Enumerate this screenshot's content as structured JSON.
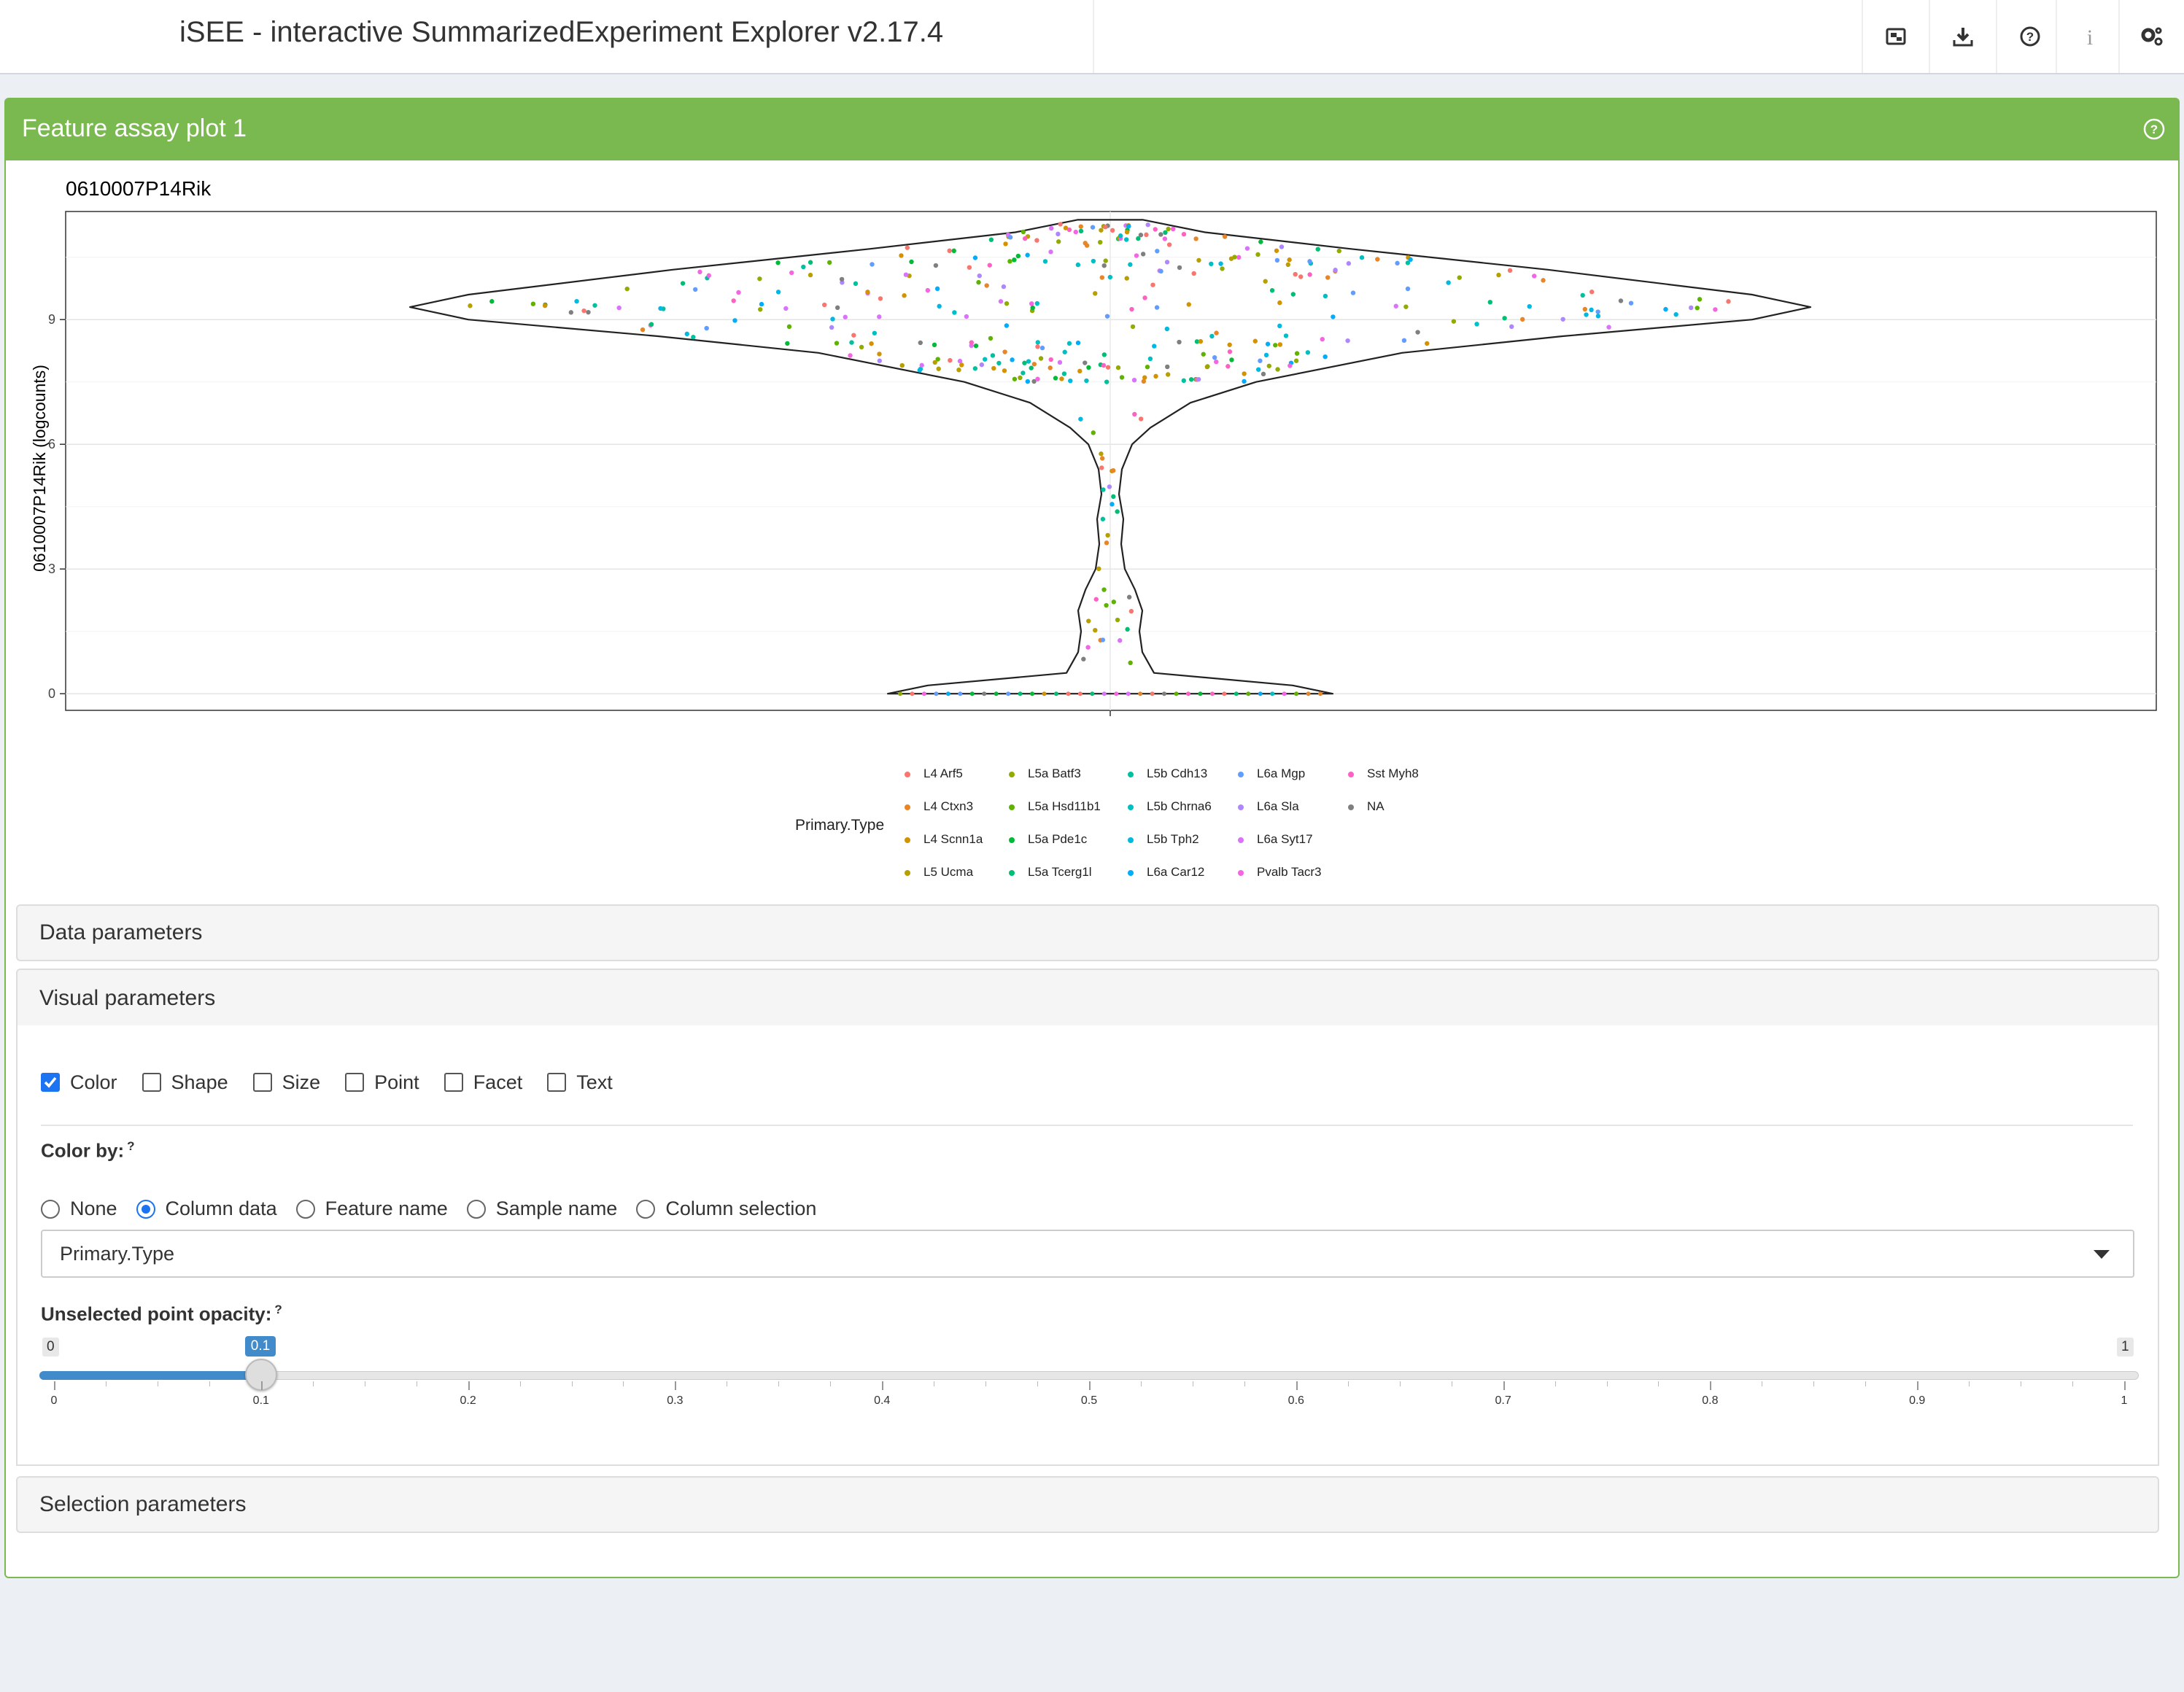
{
  "header": {
    "title": "iSEE - interactive SummarizedExperiment Explorer v2.17.4",
    "buttons": [
      {
        "name": "export-icon"
      },
      {
        "name": "download-icon"
      },
      {
        "name": "help-icon"
      },
      {
        "name": "info-icon"
      },
      {
        "name": "settings-icon"
      }
    ]
  },
  "panel": {
    "title": "Feature assay plot 1",
    "header_color": "#7ab850",
    "help_icon": "question-circle-icon"
  },
  "chart_data": {
    "type": "scatter",
    "subtype": "violin-with-jitter",
    "title": "0610007P14Rik",
    "ylabel": "0610007P14Rik (logcounts)",
    "xlabel": "",
    "ylim": [
      -0.4,
      11.6
    ],
    "yticks": [
      "0",
      "3",
      "6",
      "9"
    ],
    "grid": true,
    "legend": {
      "title": "Primary.Type",
      "placement": "bottom",
      "entries": [
        {
          "label": "L4 Arf5",
          "color": "#F8766D"
        },
        {
          "label": "L4 Ctxn3",
          "color": "#E88526"
        },
        {
          "label": "L4 Scnn1a",
          "color": "#D39200"
        },
        {
          "label": "L5 Ucma",
          "color": "#B79F00"
        },
        {
          "label": "L5a Batf3",
          "color": "#93AA00"
        },
        {
          "label": "L5a Hsd11b1",
          "color": "#5EB300"
        },
        {
          "label": "L5a Pde1c",
          "color": "#00BA38"
        },
        {
          "label": "L5a Tcerg1l",
          "color": "#00BF74"
        },
        {
          "label": "L5b Cdh13",
          "color": "#00C19F"
        },
        {
          "label": "L5b Chrna6",
          "color": "#00BFC4"
        },
        {
          "label": "L5b Tph2",
          "color": "#00B9E3"
        },
        {
          "label": "L6a Car12",
          "color": "#00ADFA"
        },
        {
          "label": "L6a Mgp",
          "color": "#619CFF"
        },
        {
          "label": "L6a Sla",
          "color": "#AE87FF"
        },
        {
          "label": "L6a Syt17",
          "color": "#DB72FB"
        },
        {
          "label": "Pvalb Tacr3",
          "color": "#F564E3"
        },
        {
          "label": "Sst Myh8",
          "color": "#FF61C3"
        },
        {
          "label": "NA",
          "color": "#7F7F7F"
        }
      ]
    }
  },
  "sections": {
    "data_params": "Data parameters",
    "visual_params": "Visual parameters",
    "selection_params": "Selection parameters"
  },
  "visual": {
    "checkboxes": [
      {
        "label": "Color",
        "checked": true
      },
      {
        "label": "Shape",
        "checked": false
      },
      {
        "label": "Size",
        "checked": false
      },
      {
        "label": "Point",
        "checked": false
      },
      {
        "label": "Facet",
        "checked": false
      },
      {
        "label": "Text",
        "checked": false
      }
    ],
    "color_by_label": "Color by:",
    "help_mark": "?",
    "color_by_options": [
      {
        "label": "None",
        "checked": false
      },
      {
        "label": "Column data",
        "checked": true
      },
      {
        "label": "Feature name",
        "checked": false
      },
      {
        "label": "Sample name",
        "checked": false
      },
      {
        "label": "Column selection",
        "checked": false
      }
    ],
    "color_column": "Primary.Type",
    "opacity_label": "Unselected point opacity:",
    "slider": {
      "min_label": "0",
      "max_label": "1",
      "value": 0.1,
      "value_label": "0.1",
      "ticks": [
        "0",
        "0.1",
        "0.2",
        "0.3",
        "0.4",
        "0.5",
        "0.6",
        "0.7",
        "0.8",
        "0.9",
        "1"
      ]
    }
  }
}
